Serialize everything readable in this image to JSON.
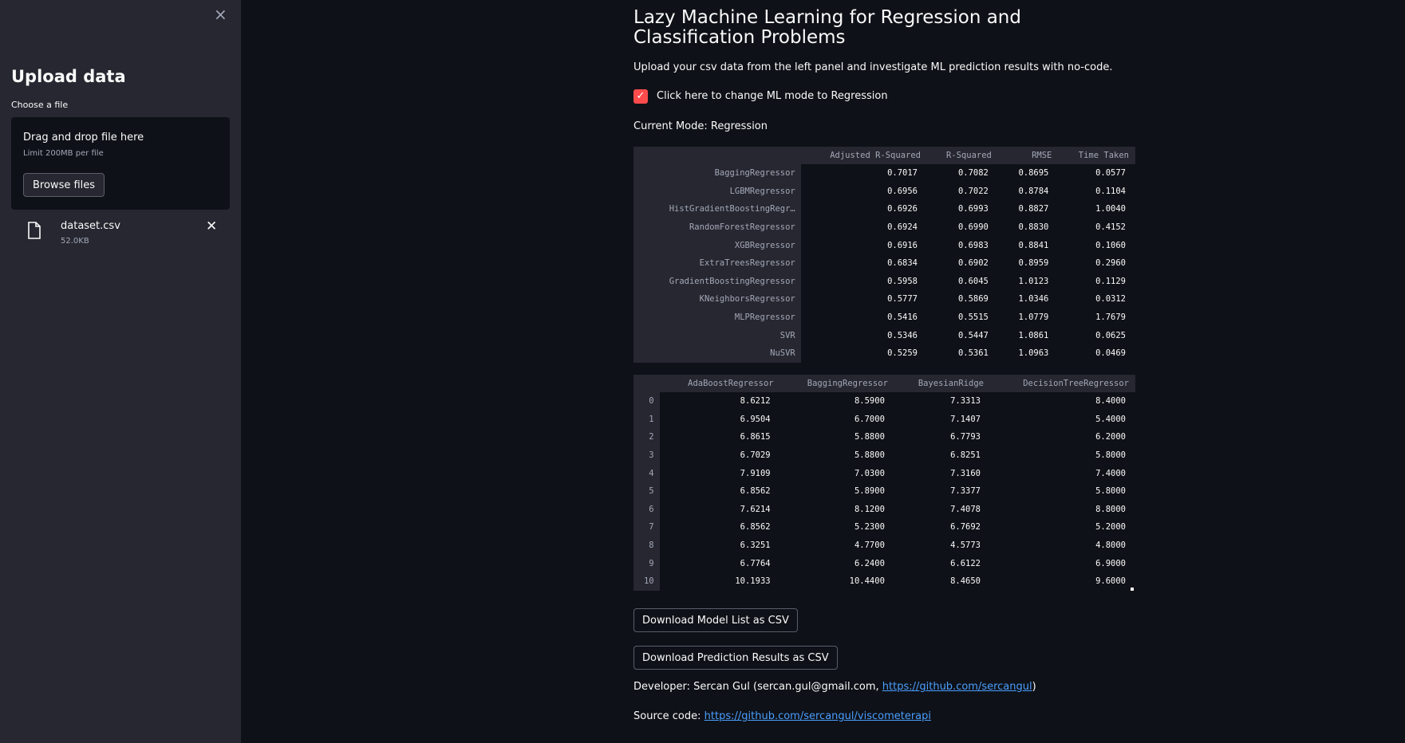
{
  "sidebar": {
    "close_glyph": "×",
    "title": "Upload data",
    "choose_label": "Choose a file",
    "dropzone": {
      "title": "Drag and drop file here",
      "limit": "Limit 200MB per file",
      "browse_label": "Browse files"
    },
    "file": {
      "name": "dataset.csv",
      "size": "52.0KB",
      "icon": "file-icon"
    }
  },
  "main": {
    "title": "Lazy Machine Learning for Regression and Classification Problems",
    "description": "Upload your csv data from the left panel and investigate ML prediction results with no-code.",
    "checkbox": {
      "checked": true,
      "label": "Click here to change ML mode to Regression",
      "color": "#ff4b4b"
    },
    "mode_text": "Current Mode: Regression",
    "models_table": {
      "columns": [
        "",
        "Adjusted R-Squared",
        "R-Squared",
        "RMSE",
        "Time Taken"
      ],
      "rows": [
        [
          "BaggingRegressor",
          "0.7017",
          "0.7082",
          "0.8695",
          "0.0577"
        ],
        [
          "LGBMRegressor",
          "0.6956",
          "0.7022",
          "0.8784",
          "0.1104"
        ],
        [
          "HistGradientBoostingRegr…",
          "0.6926",
          "0.6993",
          "0.8827",
          "1.0040"
        ],
        [
          "RandomForestRegressor",
          "0.6924",
          "0.6990",
          "0.8830",
          "0.4152"
        ],
        [
          "XGBRegressor",
          "0.6916",
          "0.6983",
          "0.8841",
          "0.1060"
        ],
        [
          "ExtraTreesRegressor",
          "0.6834",
          "0.6902",
          "0.8959",
          "0.2960"
        ],
        [
          "GradientBoostingRegressor",
          "0.5958",
          "0.6045",
          "1.0123",
          "0.1129"
        ],
        [
          "KNeighborsRegressor",
          "0.5777",
          "0.5869",
          "1.0346",
          "0.0312"
        ],
        [
          "MLPRegressor",
          "0.5416",
          "0.5515",
          "1.0779",
          "1.7679"
        ],
        [
          "SVR",
          "0.5346",
          "0.5447",
          "1.0861",
          "0.0625"
        ],
        [
          "NuSVR",
          "0.5259",
          "0.5361",
          "1.0963",
          "0.0469"
        ]
      ]
    },
    "predictions_table": {
      "columns": [
        "",
        "AdaBoostRegressor",
        "BaggingRegressor",
        "BayesianRidge",
        "DecisionTreeRegressor"
      ],
      "rows": [
        [
          "0",
          "8.6212",
          "8.5900",
          "7.3313",
          "8.4000"
        ],
        [
          "1",
          "6.9504",
          "6.7000",
          "7.1407",
          "5.4000"
        ],
        [
          "2",
          "6.8615",
          "5.8800",
          "6.7793",
          "6.2000"
        ],
        [
          "3",
          "6.7029",
          "5.8800",
          "6.8251",
          "5.8000"
        ],
        [
          "4",
          "7.9109",
          "7.0300",
          "7.3160",
          "7.4000"
        ],
        [
          "5",
          "6.8562",
          "5.8900",
          "7.3377",
          "5.8000"
        ],
        [
          "6",
          "7.6214",
          "8.1200",
          "7.4078",
          "8.8000"
        ],
        [
          "7",
          "6.8562",
          "5.2300",
          "6.7692",
          "5.2000"
        ],
        [
          "8",
          "6.3251",
          "4.7700",
          "4.5773",
          "4.8000"
        ],
        [
          "9",
          "6.7764",
          "6.2400",
          "6.6122",
          "6.9000"
        ],
        [
          "10",
          "10.1933",
          "10.4400",
          "8.4650",
          "9.6000"
        ]
      ]
    },
    "download_models_label": "Download Model List as CSV",
    "download_predictions_label": "Download Prediction Results as CSV",
    "developer": {
      "prefix": "Developer: Sercan Gul (sercan.gul@gmail.com, ",
      "link": "https://github.com/sercangul",
      "suffix": ")"
    },
    "source": {
      "prefix": "Source code: ",
      "link": "https://github.com/sercangul/viscometerapi"
    }
  },
  "colors": {
    "background": "#0e1117",
    "sidebar": "#262730",
    "accent": "#ff4b4b",
    "link": "#4a9eff"
  }
}
